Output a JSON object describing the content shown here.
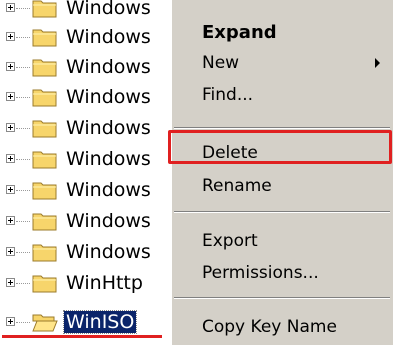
{
  "tree": {
    "items": [
      {
        "label": "Windows"
      },
      {
        "label": "Windows"
      },
      {
        "label": "Windows"
      },
      {
        "label": "Windows"
      },
      {
        "label": "Windows"
      },
      {
        "label": "Windows"
      },
      {
        "label": "Windows"
      },
      {
        "label": "Windows"
      },
      {
        "label": "Windows"
      },
      {
        "label": "WinHttp"
      },
      {
        "label": "WinISO",
        "selected": true
      }
    ]
  },
  "context_menu": {
    "expand": "Expand",
    "new": "New",
    "find": "Find...",
    "delete": "Delete",
    "rename": "Rename",
    "export": "Export",
    "permissions": "Permissions...",
    "copy_key_name": "Copy Key Name"
  },
  "colors": {
    "highlight_red": "#e02020",
    "selection_blue": "#0a246a",
    "menu_bg": "#d4d0c8",
    "folder_yellow": "#f7d56b"
  }
}
